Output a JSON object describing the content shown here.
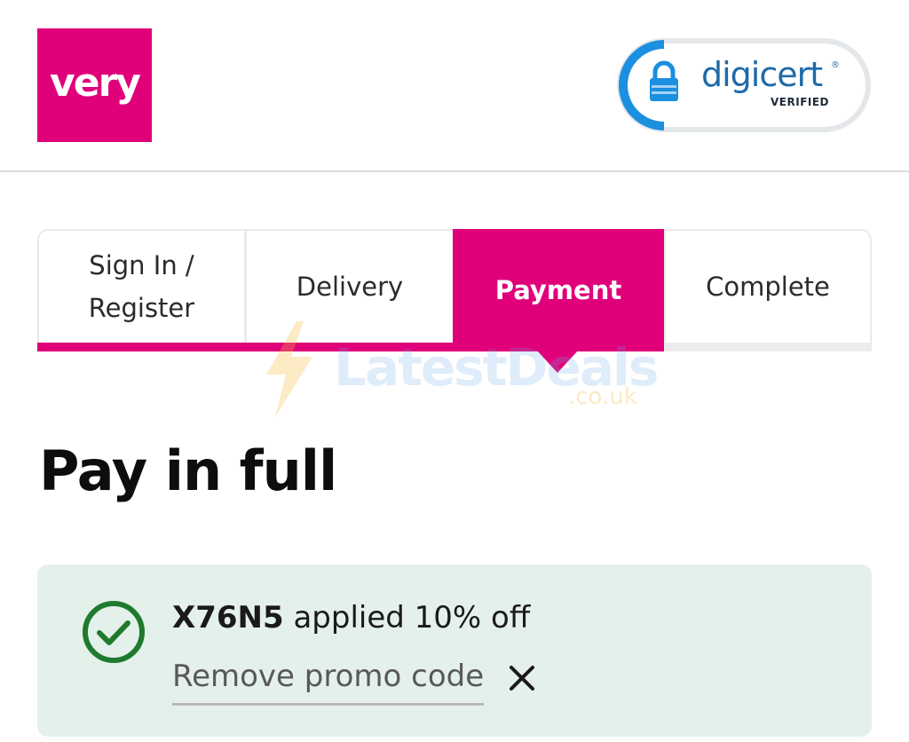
{
  "header": {
    "logo_text": "very",
    "trust_badge": {
      "brand": "digicert",
      "registered_mark": "®",
      "verified_text": "VERIFIED",
      "icon": "lock-icon"
    }
  },
  "watermark": {
    "text": "LatestDeals",
    "domain": ".co.uk"
  },
  "checkout_steps": [
    {
      "label": "Sign In /\nRegister",
      "state": "done"
    },
    {
      "label": "Delivery",
      "state": "done"
    },
    {
      "label": "Payment",
      "state": "active"
    },
    {
      "label": "Complete",
      "state": "pending"
    }
  ],
  "page_title": "Pay in full",
  "promo": {
    "code": "X76N5",
    "applied_text": " applied 10% off",
    "remove_label": "Remove promo code",
    "status_icon": "check-circle-icon",
    "remove_icon": "close-icon"
  },
  "colors": {
    "brand": "#e0007a",
    "promo_bg": "#e4f1ea",
    "success": "#1f7a2e",
    "digicert_blue": "#1f6aa8"
  }
}
